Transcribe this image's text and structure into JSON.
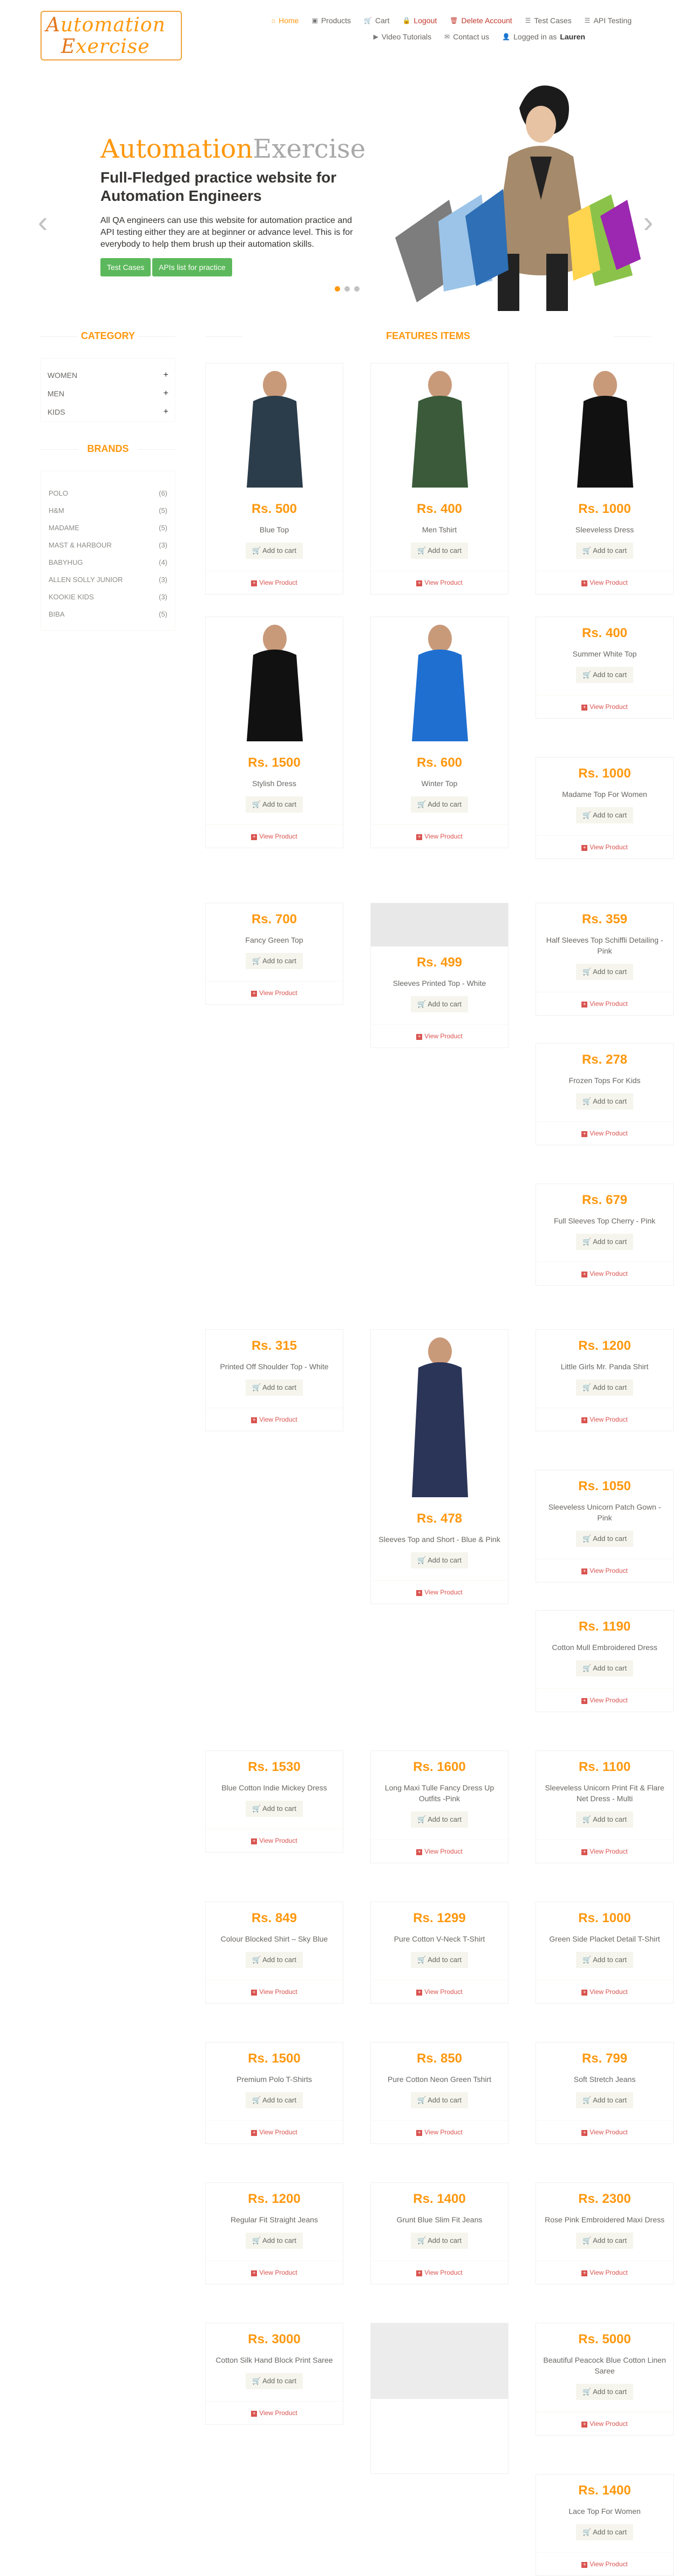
{
  "logo": {
    "line1": "Automation",
    "line2": "Exercise"
  },
  "nav": [
    {
      "label": "Home",
      "icon": "home-icon",
      "glyph": "⌂",
      "cls": "home"
    },
    {
      "label": "Products",
      "icon": "products-icon",
      "glyph": "▣",
      "cls": ""
    },
    {
      "label": "Cart",
      "icon": "cart-icon",
      "glyph": "🛒",
      "cls": ""
    },
    {
      "label": "Logout",
      "icon": "lock-icon",
      "glyph": "🔒",
      "cls": "red"
    },
    {
      "label": "Delete Account",
      "icon": "trash-icon",
      "glyph": "🗑",
      "cls": "red"
    },
    {
      "label": "Test Cases",
      "icon": "list-icon",
      "glyph": "☰",
      "cls": ""
    },
    {
      "label": "API Testing",
      "icon": "list-icon",
      "glyph": "☰",
      "cls": ""
    }
  ],
  "nav2": [
    {
      "label": "Video Tutorials",
      "icon": "youtube-icon",
      "glyph": "▶"
    },
    {
      "label": "Contact us",
      "icon": "envelope-icon",
      "glyph": "✉"
    }
  ],
  "logged": {
    "prefix": "Logged in as",
    "user": "Lauren"
  },
  "slider": {
    "brand1": "Automation",
    "brand2": "Exercise",
    "heading": "Full-Fledged practice website for Automation Engineers",
    "text": "All QA engineers can use this website for automation practice and API testing either they are at beginner or advance level. This is for everybody to help them brush up their automation skills.",
    "btn1": "Test Cases",
    "btn2": "APIs list for practice",
    "prev": "‹",
    "next": "›"
  },
  "category": {
    "title": "CATEGORY",
    "items": [
      "Women",
      "Men",
      "Kids"
    ]
  },
  "brands": {
    "title": "BRANDS",
    "items": [
      {
        "name": "Polo",
        "count": "(6)"
      },
      {
        "name": "H&M",
        "count": "(5)"
      },
      {
        "name": "Madame",
        "count": "(5)"
      },
      {
        "name": "Mast & Harbour",
        "count": "(3)"
      },
      {
        "name": "Babyhug",
        "count": "(4)"
      },
      {
        "name": "Allen Solly Junior",
        "count": "(3)"
      },
      {
        "name": "Kookie Kids",
        "count": "(3)"
      },
      {
        "name": "Biba",
        "count": "(5)"
      }
    ]
  },
  "features_title": "FEATURES ITEMS",
  "add_to_cart": "Add to cart",
  "view_product": "View Product",
  "products": [
    {
      "price": "Rs. 500",
      "name": "Blue Top"
    },
    {
      "price": "Rs. 400",
      "name": "Men Tshirt"
    },
    {
      "price": "Rs. 1000",
      "name": "Sleeveless Dress"
    },
    {
      "price": "Rs. 1500",
      "name": "Stylish Dress"
    },
    {
      "price": "Rs. 600",
      "name": "Winter Top"
    },
    {
      "price": "Rs. 400",
      "name": "Summer White Top"
    },
    {
      "price": "Rs. 1000",
      "name": "Madame Top For Women"
    },
    {
      "price": "Rs. 700",
      "name": "Fancy Green Top"
    },
    {
      "price": "Rs. 499",
      "name": "Sleeves Printed Top - White"
    },
    {
      "price": "Rs. 359",
      "name": "Half Sleeves Top Schiffli Detailing - Pink"
    },
    {
      "price": "Rs. 278",
      "name": "Frozen Tops For Kids"
    },
    {
      "price": "Rs. 679",
      "name": "Full Sleeves Top Cherry - Pink"
    },
    {
      "price": "Rs. 315",
      "name": "Printed Off Shoulder Top - White"
    },
    {
      "price": "Rs. 478",
      "name": "Sleeves Top and Short - Blue & Pink"
    },
    {
      "price": "Rs. 1200",
      "name": "Little Girls Mr. Panda Shirt"
    },
    {
      "price": "Rs. 1050",
      "name": "Sleeveless Unicorn Patch Gown - Pink"
    },
    {
      "price": "Rs. 1190",
      "name": "Cotton Mull Embroidered Dress"
    },
    {
      "price": "Rs. 1530",
      "name": "Blue Cotton Indie Mickey Dress"
    },
    {
      "price": "Rs. 1600",
      "name": "Long Maxi Tulle Fancy Dress Up Outfits -Pink"
    },
    {
      "price": "Rs. 1100",
      "name": "Sleeveless Unicorn Print Fit & Flare Net Dress - Multi"
    },
    {
      "price": "Rs. 849",
      "name": "Colour Blocked Shirt – Sky Blue"
    },
    {
      "price": "Rs. 1299",
      "name": "Pure Cotton V-Neck T-Shirt"
    },
    {
      "price": "Rs. 1000",
      "name": "Green Side Placket Detail T-Shirt"
    },
    {
      "price": "Rs. 1500",
      "name": "Premium Polo T-Shirts"
    },
    {
      "price": "Rs. 850",
      "name": "Pure Cotton Neon Green Tshirt"
    },
    {
      "price": "Rs. 799",
      "name": "Soft Stretch Jeans"
    },
    {
      "price": "Rs. 1200",
      "name": "Regular Fit Straight Jeans"
    },
    {
      "price": "Rs. 1400",
      "name": "Grunt Blue Slim Fit Jeans"
    },
    {
      "price": "Rs. 2300",
      "name": "Rose Pink Embroidered Maxi Dress"
    },
    {
      "price": "Rs. 3000",
      "name": "Cotton Silk Hand Block Print Saree"
    },
    {
      "price": "",
      "name": ""
    },
    {
      "price": "Rs. 5000",
      "name": "Beautiful Peacock Blue Cotton Linen Saree"
    },
    {
      "price": "Rs. 1400",
      "name": "Lace Top For Women"
    }
  ]
}
